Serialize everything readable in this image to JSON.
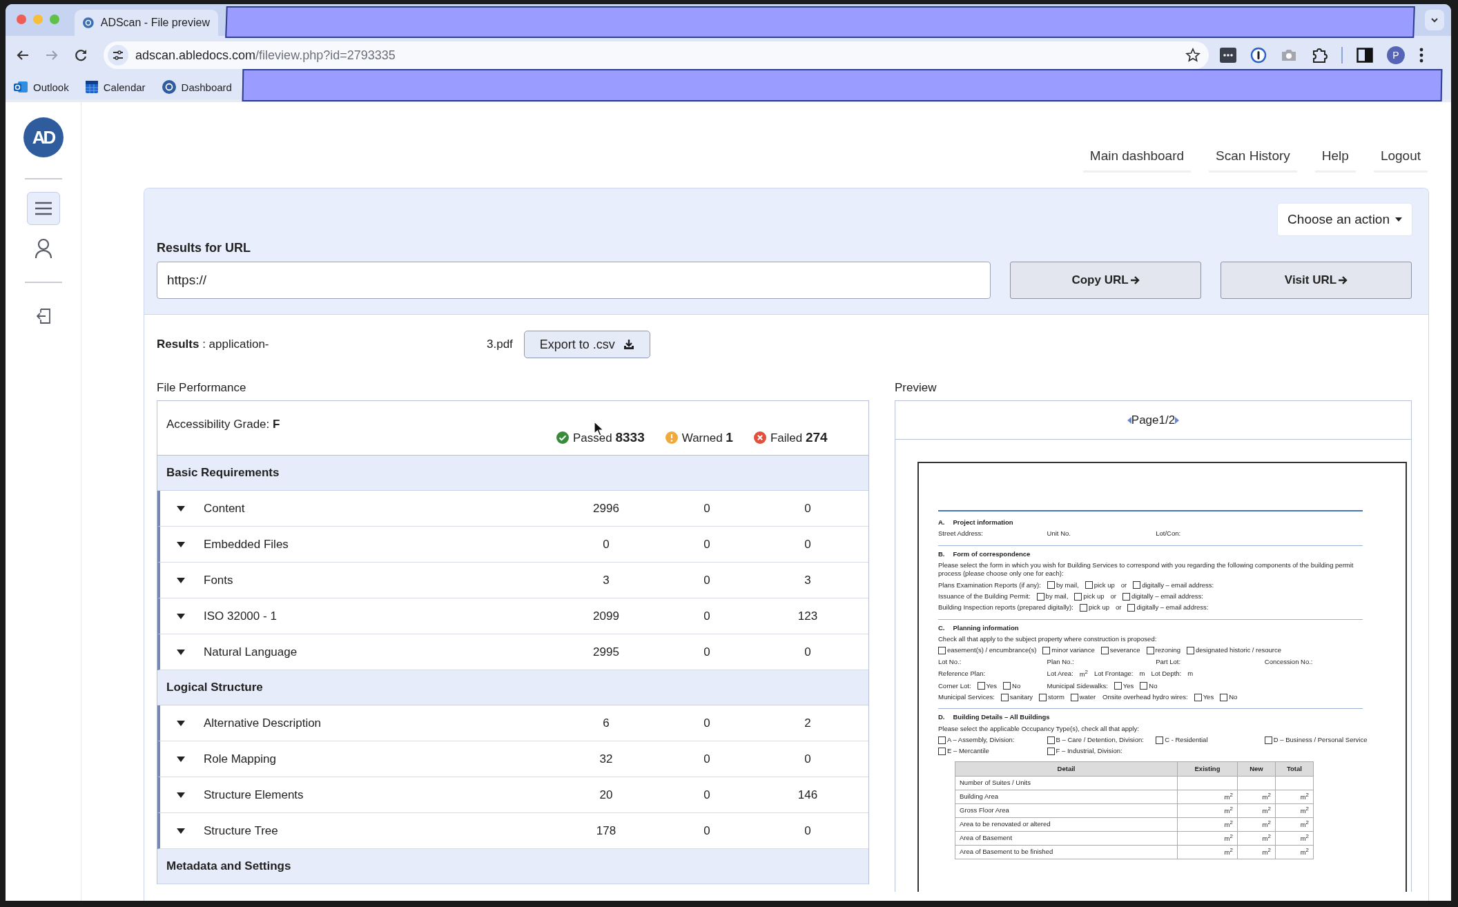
{
  "browser": {
    "tab_title": "ADScan - File preview",
    "url_host": "adscan.abledocs.com",
    "url_path": "/fileview.php?id=2793335",
    "profile_initial": "P",
    "bookmarks": [
      {
        "label": "Outlook",
        "kind": "mail"
      },
      {
        "label": "Calendar",
        "kind": "calendar"
      },
      {
        "label": "Dashboard",
        "kind": "logo"
      }
    ]
  },
  "sidebar": {
    "logo": "AD",
    "items": [
      {
        "kind": "menu",
        "selected": true
      },
      {
        "kind": "user",
        "selected": false
      },
      {
        "kind": "logout",
        "selected": false
      }
    ]
  },
  "nav": [
    "Main dashboard",
    "Scan History",
    "Help",
    "Logout"
  ],
  "url_panel": {
    "action_button": "Choose an action",
    "title": "Results for URL",
    "url_value": "https://",
    "buttons": [
      "Copy URL",
      "Visit URL"
    ]
  },
  "results": {
    "label": "**Results** : application-",
    "file_tail": "3.pdf",
    "export_button": "Export to .csv"
  },
  "performance": {
    "title": "File Performance",
    "grade": "Accessibility Grade: **F**",
    "summary": [
      {
        "kind": "passed",
        "text": "Passed **8333**"
      },
      {
        "kind": "warned",
        "text": "Warned **1**"
      },
      {
        "kind": "failed",
        "text": "Failed **274**"
      }
    ],
    "sections": [
      {
        "title": "Basic Requirements",
        "rows": [
          {
            "name": "Content",
            "passed": "2996",
            "warned": "0",
            "failed": "0"
          },
          {
            "name": "Embedded Files",
            "passed": "0",
            "warned": "0",
            "failed": "0"
          },
          {
            "name": "Fonts",
            "passed": "3",
            "warned": "0",
            "failed": "3"
          },
          {
            "name": "ISO 32000 - 1",
            "passed": "2099",
            "warned": "0",
            "failed": "123"
          },
          {
            "name": "Natural Language",
            "passed": "2995",
            "warned": "0",
            "failed": "0"
          }
        ]
      },
      {
        "title": "Logical Structure",
        "rows": [
          {
            "name": "Alternative Description",
            "passed": "6",
            "warned": "0",
            "failed": "2"
          },
          {
            "name": "Role Mapping",
            "passed": "32",
            "warned": "0",
            "failed": "0"
          },
          {
            "name": "Structure Elements",
            "passed": "20",
            "warned": "0",
            "failed": "146"
          },
          {
            "name": "Structure Tree",
            "passed": "178",
            "warned": "0",
            "failed": "0"
          }
        ]
      },
      {
        "title": "Metadata and Settings"
      }
    ]
  },
  "preview": {
    "title": "Preview",
    "page_label": "Page1/2",
    "document": {
      "sections": [
        {
          "letter": "A.",
          "title": "Project information",
          "lines": [
            {
              "groups": [
                [
                  {
                    "kind": "label",
                    "text": "Street Address:"
                  }
                ],
                [
                  {
                    "kind": "label",
                    "text": "Unit No."
                  }
                ],
                [
                  {
                    "kind": "label",
                    "text": "Lot/Con:"
                  }
                ]
              ]
            }
          ]
        },
        {
          "letter": "B.",
          "title": "Form of correspondence",
          "lines": [
            {
              "text": "Please select the form in which you wish for Building Services to correspond with you regarding the following components of the building permit process (please choose only one for each):"
            },
            {
              "groups": [
                [
                  {
                    "kind": "label",
                    "text": "Plans Examination Reports (if any):"
                  },
                  {
                    "kind": "checkbox",
                    "text": "by mail,",
                    "checked": false
                  },
                  {
                    "kind": "checkbox",
                    "text": "pick up",
                    "checked": false
                  },
                  {
                    "kind": "label",
                    "text": "or"
                  },
                  {
                    "kind": "checkbox",
                    "text": "digitally – email address:",
                    "checked": false
                  }
                ]
              ]
            },
            {
              "groups": [
                [
                  {
                    "kind": "label",
                    "text": "Issuance of the Building Permit:"
                  },
                  {
                    "kind": "checkbox",
                    "text": "by mail,",
                    "checked": false
                  },
                  {
                    "kind": "checkbox",
                    "text": "pick up",
                    "checked": false
                  },
                  {
                    "kind": "label",
                    "text": "or"
                  },
                  {
                    "kind": "checkbox",
                    "text": "digitally – email address:",
                    "checked": false
                  }
                ]
              ]
            },
            {
              "groups": [
                [
                  {
                    "kind": "label",
                    "text": "Building Inspection reports (prepared digitally):"
                  },
                  {
                    "kind": "checkbox",
                    "text": "pick up",
                    "checked": false
                  },
                  {
                    "kind": "label",
                    "text": "or"
                  },
                  {
                    "kind": "checkbox",
                    "text": "digitally – email address:",
                    "checked": false
                  }
                ]
              ]
            }
          ]
        },
        {
          "letter": "C.",
          "title": "Planning information",
          "lines": [
            {
              "text": "Check all that apply to the subject property where construction is proposed:"
            },
            {
              "groups": [
                [
                  {
                    "kind": "checkbox",
                    "text": "easement(s) / encumbrance(s)",
                    "checked": false
                  },
                  {
                    "kind": "checkbox",
                    "text": "minor variance",
                    "checked": false
                  },
                  {
                    "kind": "checkbox",
                    "text": "severance",
                    "checked": false
                  },
                  {
                    "kind": "checkbox",
                    "text": "rezoning",
                    "checked": false
                  },
                  {
                    "kind": "checkbox",
                    "text": "designated historic / resource",
                    "checked": false
                  }
                ]
              ]
            },
            {
              "groups": [
                [
                  {
                    "kind": "label",
                    "text": "Lot No.:"
                  }
                ],
                [
                  {
                    "kind": "label",
                    "text": "Plan No.:"
                  }
                ],
                [
                  {
                    "kind": "label",
                    "text": "Part Lot:"
                  }
                ],
                [
                  {
                    "kind": "label",
                    "text": "Concession No.:"
                  }
                ]
              ]
            },
            {
              "groups": [
                [
                  {
                    "kind": "label",
                    "text": "Reference Plan:"
                  }
                ],
                [
                  {
                    "kind": "label",
                    "text": "Lot Area:"
                  },
                  {
                    "kind": "label",
                    "text": "m$^{2}$"
                  },
                  {
                    "kind": "label",
                    "text": "Lot Frontage:"
                  },
                  {
                    "kind": "label",
                    "text": "m"
                  },
                  {
                    "kind": "label",
                    "text": "Lot Depth:"
                  },
                  {
                    "kind": "label",
                    "text": "m"
                  }
                ]
              ]
            },
            {
              "groups": [
                [
                  {
                    "kind": "label",
                    "text": "Corner Lot:"
                  },
                  {
                    "kind": "checkbox",
                    "text": "Yes",
                    "checked": false
                  },
                  {
                    "kind": "checkbox",
                    "text": "No",
                    "checked": false
                  }
                ],
                [
                  {
                    "kind": "label",
                    "text": "Municipal Sidewalks:"
                  },
                  {
                    "kind": "checkbox",
                    "text": "Yes",
                    "checked": false
                  },
                  {
                    "kind": "checkbox",
                    "text": "No",
                    "checked": false
                  }
                ]
              ]
            },
            {
              "groups": [
                [
                  {
                    "kind": "label",
                    "text": "Municipal Services:"
                  },
                  {
                    "kind": "checkbox",
                    "text": "sanitary",
                    "checked": false
                  },
                  {
                    "kind": "checkbox",
                    "text": "storm",
                    "checked": false
                  },
                  {
                    "kind": "checkbox",
                    "text": "water",
                    "checked": false
                  }
                ],
                [
                  {
                    "kind": "label",
                    "text": "Onsite overhead hydro wires:"
                  },
                  {
                    "kind": "checkbox",
                    "text": "Yes",
                    "checked": false
                  },
                  {
                    "kind": "checkbox",
                    "text": "No",
                    "checked": false
                  }
                ]
              ]
            }
          ]
        },
        {
          "letter": "D.",
          "title": "Building Details – All Buildings",
          "lines": [
            {
              "text": "Please select the applicable Occupancy Type(s), check all that apply:"
            },
            {
              "groups": [
                [
                  {
                    "kind": "checkbox",
                    "text": "A – Assembly, Division:",
                    "checked": false
                  }
                ],
                [
                  {
                    "kind": "checkbox",
                    "text": "B – Care / Detention, Division:",
                    "checked": false
                  }
                ],
                [
                  {
                    "kind": "checkbox",
                    "text": "C - Residential",
                    "checked": false
                  }
                ],
                [
                  {
                    "kind": "checkbox",
                    "text": "D – Business / Personal Service",
                    "checked": false
                  }
                ]
              ]
            },
            {
              "groups": [
                [
                  {
                    "kind": "checkbox",
                    "text": "E – Mercantile",
                    "checked": false
                  }
                ],
                [
                  {
                    "kind": "checkbox",
                    "text": "F – Industrial, Division:",
                    "checked": false
                  }
                ]
              ]
            }
          ],
          "table": {
            "columns": [
              "Detail",
              "Existing",
              "New",
              "Total"
            ],
            "rows": [
              {
                "cells": [
                  "Number of Suites / Units"
                ]
              },
              {
                "cells": [
                  "Building Area",
                  "m$^{2}$",
                  "m$^{2}$",
                  "m$^{2}$"
                ]
              },
              {
                "cells": [
                  "Gross Floor Area",
                  "m$^{2}$",
                  "m$^{2}$",
                  "m$^{2}$"
                ]
              },
              {
                "cells": [
                  "Area to be renovated or altered",
                  "m$^{2}$",
                  "m$^{2}$",
                  "m$^{2}$"
                ]
              },
              {
                "cells": [
                  "Area of Basement",
                  "m$^{2}$",
                  "m$^{2}$",
                  "m$^{2}$"
                ]
              },
              {
                "cells": [
                  "Area of Basement to be finished",
                  "m$^{2}$",
                  "m$^{2}$",
                  "m$^{2}$"
                ]
              }
            ]
          }
        }
      ]
    }
  }
}
